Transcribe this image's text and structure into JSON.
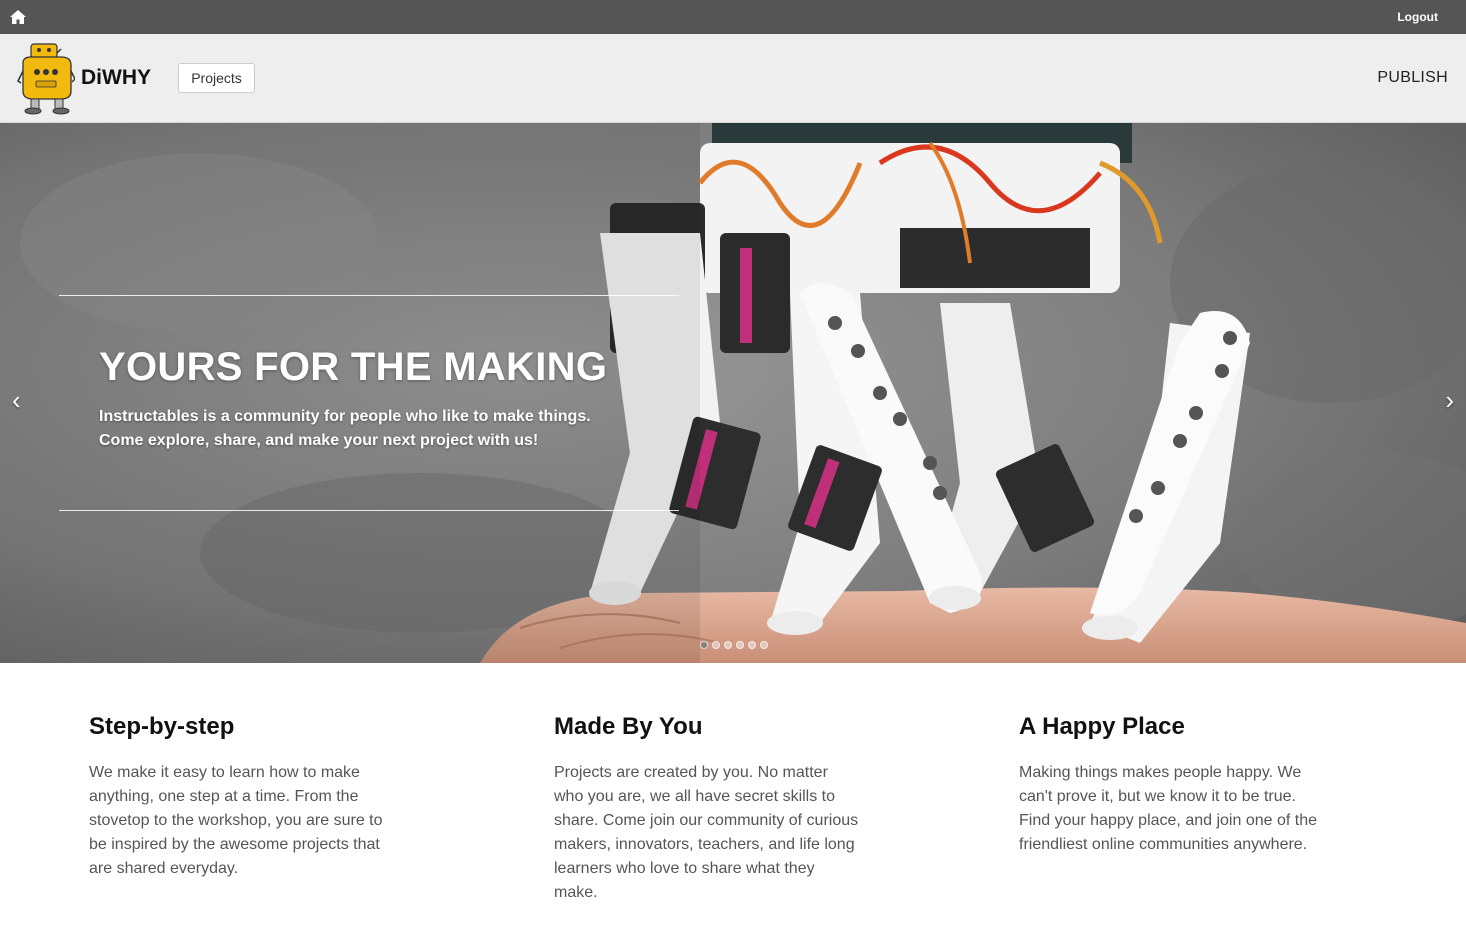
{
  "topbar": {
    "home_icon": "home-icon",
    "logout_label": "Logout"
  },
  "header": {
    "logo_icon": "robot-mascot-logo",
    "brand": "DiWHY",
    "projects_label": "Projects",
    "publish_label": "PUBLISH"
  },
  "hero": {
    "title": "YOURS FOR THE MAKING",
    "subtitle_line1": "Instructables is a community for people who like to make things.",
    "subtitle_line2": "Come explore, share, and make your next project with us!",
    "prev_label": "‹",
    "next_label": "›",
    "slide_count": 6,
    "active_slide": 1
  },
  "features": [
    {
      "title": "Step-by-step",
      "text": "We make it easy to learn how to make anything, one step at a time. From the stovetop to the workshop, you are sure to be inspired by the awesome projects that are shared everyday."
    },
    {
      "title": "Made By You",
      "text": "Projects are created by you. No matter who you are, we all have secret skills to share. Come join our community of curious makers, innovators, teachers, and life long learners who love to share what they make."
    },
    {
      "title": "A Happy Place",
      "text": "Making things makes people happy. We can't prove it, but we know it to be true. Find your happy place, and join one of the friendliest online communities anywhere."
    }
  ],
  "colors": {
    "topbar": "#555555",
    "header": "#eeeeee",
    "logo_yellow": "#f2b90f",
    "text_dark": "#111111",
    "text_body": "#555555"
  }
}
